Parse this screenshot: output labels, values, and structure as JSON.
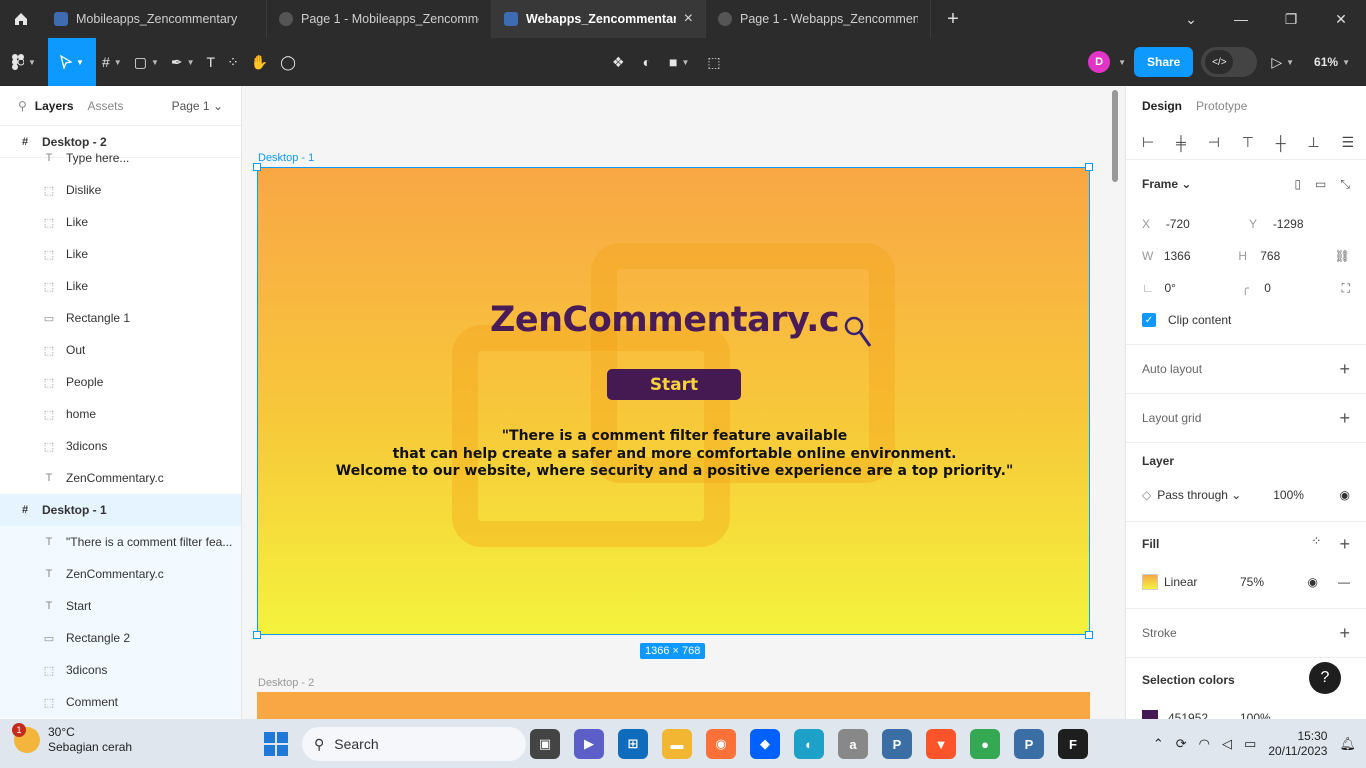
{
  "tabs": [
    {
      "title": "Mobileapps_Zencommentary",
      "active": false
    },
    {
      "title": "Page 1 - Mobileapps_Zencommentary",
      "active": false
    },
    {
      "title": "Webapps_Zencommentary",
      "active": true
    },
    {
      "title": "Page 1 - Webapps_Zencommentary",
      "active": false
    }
  ],
  "toolbar": {
    "avatar_initial": "D",
    "share_label": "Share",
    "zoom": "61%"
  },
  "layers_panel": {
    "tab_layers": "Layers",
    "tab_assets": "Assets",
    "page": "Page 1",
    "frame2_name": "Desktop - 2",
    "frame2_children": [
      {
        "name": "Type here...",
        "kind": "text"
      },
      {
        "name": "Dislike",
        "kind": "image"
      },
      {
        "name": "Like",
        "kind": "image"
      },
      {
        "name": "Like",
        "kind": "image"
      },
      {
        "name": "Like",
        "kind": "image"
      },
      {
        "name": "Rectangle 1",
        "kind": "rect"
      },
      {
        "name": "Out",
        "kind": "image"
      },
      {
        "name": "People",
        "kind": "image"
      },
      {
        "name": "home",
        "kind": "image"
      },
      {
        "name": "3dicons",
        "kind": "image"
      },
      {
        "name": "ZenCommentary.c",
        "kind": "text"
      }
    ],
    "frame1_name": "Desktop - 1",
    "frame1_children": [
      {
        "name": "\"There is a comment filter fea...",
        "kind": "text"
      },
      {
        "name": "ZenCommentary.c",
        "kind": "text"
      },
      {
        "name": "Start",
        "kind": "text"
      },
      {
        "name": "Rectangle 2",
        "kind": "rect"
      },
      {
        "name": "3dicons",
        "kind": "image"
      },
      {
        "name": "Comment",
        "kind": "image"
      }
    ]
  },
  "canvas": {
    "frame1_label": "Desktop - 1",
    "frame2_label": "Desktop - 2",
    "size_badge": "1366 × 768",
    "title": "ZenCommentary.c",
    "start_label": "Start",
    "quote_lines": [
      "\"There is a comment filter feature available",
      "that can help create a safer and more comfortable online environment.",
      "Welcome to our website, where security and a positive experience are a top priority.\""
    ]
  },
  "design_panel": {
    "tab_design": "Design",
    "tab_prototype": "Prototype",
    "frame_label": "Frame",
    "x_key": "X",
    "x": "-720",
    "y_key": "Y",
    "y": "-1298",
    "w_key": "W",
    "w": "1366",
    "h_key": "H",
    "h": "768",
    "rotation": "0°",
    "radius": "0",
    "clip_content": "Clip content",
    "auto_layout": "Auto layout",
    "layout_grid": "Layout grid",
    "layer_label": "Layer",
    "blend_mode": "Pass through",
    "layer_opacity": "100%",
    "fill_label": "Fill",
    "fill_type": "Linear",
    "fill_opacity": "75%",
    "stroke_label": "Stroke",
    "selection_colors": "Selection colors",
    "sel_color_hex": "451952",
    "sel_color_opacity": "100%",
    "help": "?"
  },
  "taskbar": {
    "temp": "30°C",
    "condition": "Sebagian cerah",
    "weather_badge": "1",
    "search_label": "Search",
    "time": "15:30",
    "date": "20/11/2023"
  },
  "colors": {
    "accent": "#0d99ff",
    "brand_purple": "#451952",
    "start_text": "#f6d23c"
  }
}
